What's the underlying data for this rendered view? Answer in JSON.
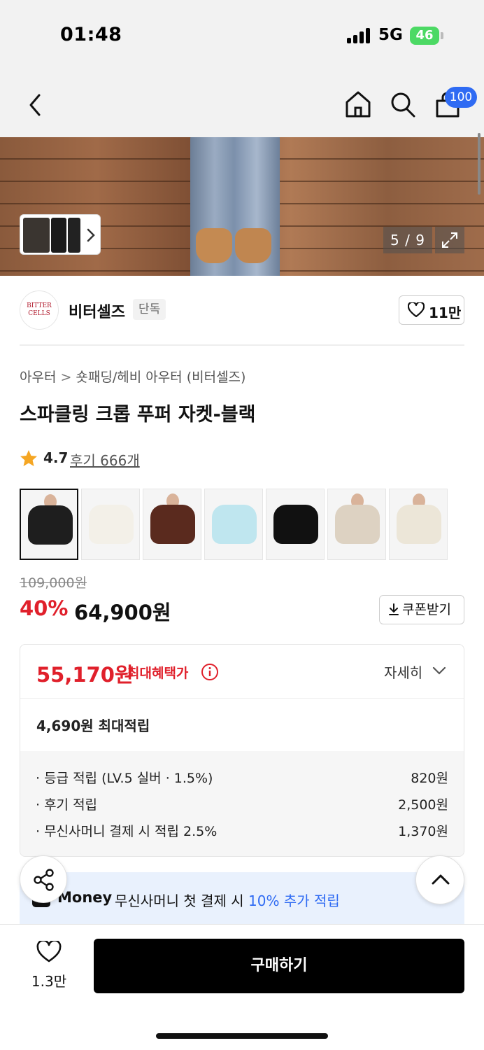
{
  "status_bar": {
    "time": "01:48",
    "network": "5G",
    "battery": "46"
  },
  "nav": {
    "cart_count": "100"
  },
  "gallery": {
    "page_indicator": "5 / 9"
  },
  "brand": {
    "logo_text_line1": "BITTER",
    "logo_text_line2": "CELLS",
    "name": "비터셀즈",
    "tag": "단독",
    "like_count": "11만"
  },
  "product": {
    "breadcrumb": [
      "아우터",
      "숏패딩/헤비 아우터 (비터셀즈)"
    ],
    "breadcrumb_sep": ">",
    "title": "스파클링 크롭 푸퍼 자켓-블랙",
    "rating": "4.7",
    "reviews": "후기 666개",
    "original_price": "109,000원",
    "discount": "40%",
    "sale_price": "64,900원",
    "coupon_label": "쿠폰받기",
    "swatch_colors": [
      "#1e1e1e",
      "#f3f0e8",
      "#5a2a1e",
      "#bfe6ef",
      "#111111",
      "#ddd2c2",
      "#ece6d8"
    ]
  },
  "benefit": {
    "best_price": "55,170원",
    "best_label": "최대혜택가",
    "detail_label": "자세히",
    "points": "4,690원 최대적립",
    "rows": [
      {
        "label": "· 등급 적립 (LV.5 실버 · 1.5%)",
        "value": "820원"
      },
      {
        "label": "· 후기 적립",
        "value": "2,500원"
      },
      {
        "label": "· 무신사머니 결제 시 적립 2.5%",
        "value": "1,370원"
      }
    ]
  },
  "money_banner": {
    "brand": "Money",
    "text": "무신사머니 첫 결제 시 ",
    "highlight": "10% 추가 적립"
  },
  "bottom": {
    "wish_count": "1.3만",
    "buy_label": "구매하기"
  }
}
